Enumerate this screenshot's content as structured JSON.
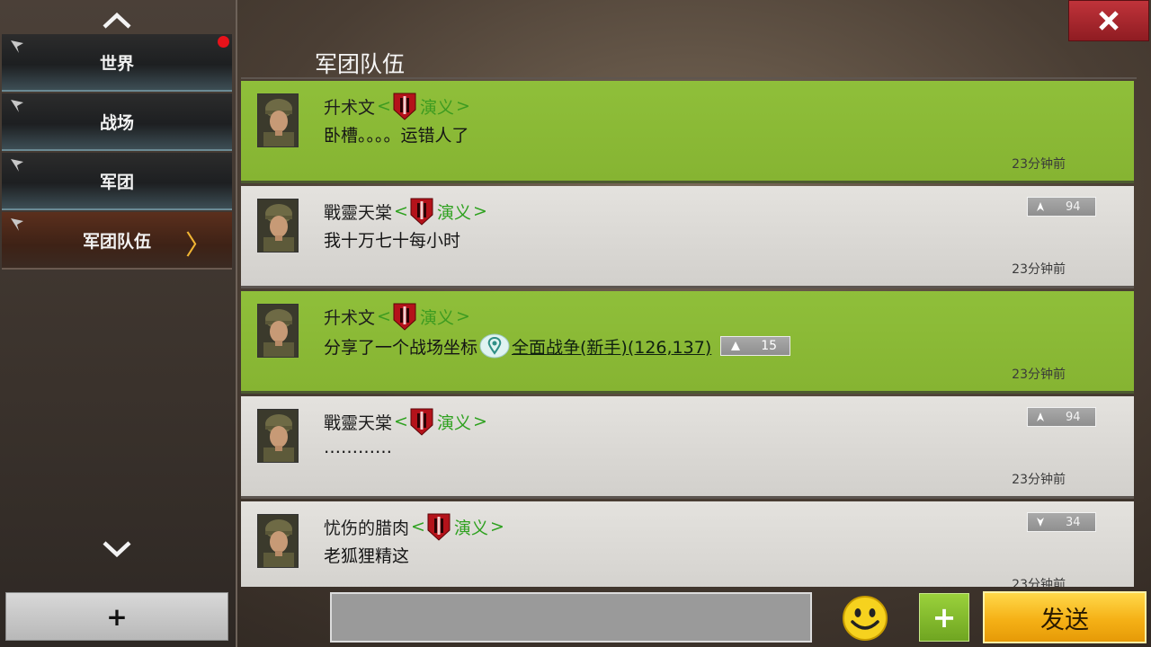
{
  "sidebar": {
    "tabs": [
      {
        "label": "世界",
        "unread": true
      },
      {
        "label": "战场",
        "unread": false
      },
      {
        "label": "军团",
        "unread": false
      },
      {
        "label": "军团队伍",
        "unread": false,
        "active": true
      }
    ],
    "add_label": "+"
  },
  "header": {
    "title": "军团队伍",
    "close_label": "✕"
  },
  "messages": [
    {
      "author": "升术文",
      "tag": "演义",
      "text": "卧槽。。。。运错人了",
      "time": "23分钟前",
      "highlight": true
    },
    {
      "author": "戰靈天棠",
      "tag": "演义",
      "text": "我十万七十每小时",
      "time": "23分钟前",
      "highlight": false,
      "rank": "94",
      "rank_dir": "up"
    },
    {
      "author": "升术文",
      "tag": "演义",
      "text": "分享了一个战场坐标",
      "location": "全面战争(新手)(126,137)",
      "location_rank": "15",
      "time": "23分钟前",
      "highlight": true
    },
    {
      "author": "戰靈天棠",
      "tag": "演义",
      "text": "…………",
      "time": "23分钟前",
      "highlight": false,
      "rank": "94",
      "rank_dir": "up"
    },
    {
      "author": "忧伤的腊肉",
      "tag": "演义",
      "text": "老狐狸精这",
      "time": "23分钟前",
      "highlight": false,
      "rank": "34",
      "rank_dir": "down"
    }
  ],
  "composer": {
    "input_value": "",
    "placeholder": "",
    "add_label": "+",
    "send_label": "发送"
  },
  "colors": {
    "highlight_green": "#8fbf3a",
    "tag_green": "#2ea11f",
    "send_yellow": "#f5b116",
    "close_red": "#c0333a"
  },
  "icons": [
    "chevron-up-icon",
    "chevron-down-icon",
    "flag-icon",
    "legion-shield-icon",
    "location-pin-icon",
    "rank-arrow-icon",
    "smiley-icon",
    "close-icon"
  ]
}
